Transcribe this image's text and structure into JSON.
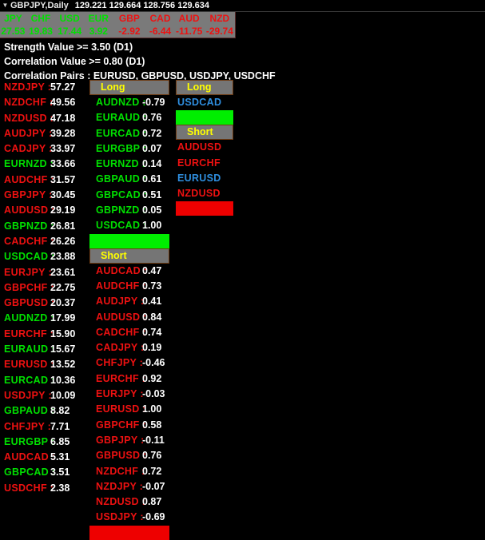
{
  "titlebar": {
    "caret_icon": "chevron-down-icon",
    "symbol": "GBPJPY,Daily",
    "quotes": "129.221 129.664 128.756 129.634"
  },
  "strength_panel": {
    "currencies": [
      "JPY",
      "CHF",
      "USD",
      "EUR",
      "GBP",
      "CAD",
      "AUD",
      "NZD"
    ],
    "values": [
      "27.53",
      "19.83",
      "17.44",
      "3.92",
      "-2.92",
      "-6.44",
      "-11.75",
      "-29.74"
    ]
  },
  "criteria": {
    "line1": "Strength Value >= 3.50    (D1)",
    "line2": "Correlation Value >= 0.80    (D1)",
    "line3": "Correlation Pairs : EURUSD, GBPUSD, USDJPY, USDCHF"
  },
  "strength_list": {
    "rows": [
      {
        "pair": "NZDJPY :",
        "value": "57.27",
        "dir": "down"
      },
      {
        "pair": "NZDCHF :",
        "value": "49.56",
        "dir": "down"
      },
      {
        "pair": "NZDUSD :",
        "value": "47.18",
        "dir": "down"
      },
      {
        "pair": "AUDJPY :",
        "value": "39.28",
        "dir": "down"
      },
      {
        "pair": "CADJPY :",
        "value": "33.97",
        "dir": "down"
      },
      {
        "pair": "EURNZD :",
        "value": "33.66",
        "dir": "up"
      },
      {
        "pair": "AUDCHF :",
        "value": "31.57",
        "dir": "down"
      },
      {
        "pair": "GBPJPY :",
        "value": "30.45",
        "dir": "down"
      },
      {
        "pair": "AUDUSD :",
        "value": "29.19",
        "dir": "down"
      },
      {
        "pair": "GBPNZD :",
        "value": "26.81",
        "dir": "up"
      },
      {
        "pair": "CADCHF :",
        "value": "26.26",
        "dir": "down"
      },
      {
        "pair": "USDCAD :",
        "value": "23.88",
        "dir": "up"
      },
      {
        "pair": "EURJPY :",
        "value": "23.61",
        "dir": "down"
      },
      {
        "pair": "GBPCHF :",
        "value": "22.75",
        "dir": "down"
      },
      {
        "pair": "GBPUSD :",
        "value": "20.37",
        "dir": "down"
      },
      {
        "pair": "AUDNZD :",
        "value": "17.99",
        "dir": "up"
      },
      {
        "pair": "EURCHF :",
        "value": "15.90",
        "dir": "down"
      },
      {
        "pair": "EURAUD :",
        "value": "15.67",
        "dir": "up"
      },
      {
        "pair": "EURUSD :",
        "value": "13.52",
        "dir": "down"
      },
      {
        "pair": "EURCAD :",
        "value": "10.36",
        "dir": "up"
      },
      {
        "pair": "USDJPY :",
        "value": "10.09",
        "dir": "down"
      },
      {
        "pair": "GBPAUD :",
        "value": "8.82",
        "dir": "up"
      },
      {
        "pair": "CHFJPY :",
        "value": "7.71",
        "dir": "down"
      },
      {
        "pair": "EURGBP :",
        "value": "6.85",
        "dir": "up"
      },
      {
        "pair": "AUDCAD :",
        "value": "5.31",
        "dir": "down"
      },
      {
        "pair": "GBPCAD :",
        "value": "3.51",
        "dir": "up"
      },
      {
        "pair": "USDCHF :",
        "value": "2.38",
        "dir": "down"
      }
    ]
  },
  "correlation": {
    "long_header": "Long",
    "short_header": "Short",
    "long_rows": [
      {
        "pair": "AUDNZD :",
        "value": "-0.79"
      },
      {
        "pair": "EURAUD :",
        "value": "0.76"
      },
      {
        "pair": "EURCAD :",
        "value": "0.72"
      },
      {
        "pair": "EURGBP :",
        "value": "0.07"
      },
      {
        "pair": "EURNZD :",
        "value": "0.14"
      },
      {
        "pair": "GBPAUD :",
        "value": "0.61"
      },
      {
        "pair": "GBPCAD :",
        "value": "0.51"
      },
      {
        "pair": "GBPNZD :",
        "value": "0.05"
      },
      {
        "pair": "USDCAD :",
        "value": "1.00"
      }
    ],
    "short_rows": [
      {
        "pair": "AUDCAD :",
        "value": "0.47"
      },
      {
        "pair": "AUDCHF :",
        "value": "0.73"
      },
      {
        "pair": "AUDJPY :",
        "value": "0.41"
      },
      {
        "pair": "AUDUSD :",
        "value": "0.84"
      },
      {
        "pair": "CADCHF :",
        "value": "0.74"
      },
      {
        "pair": "CADJPY :",
        "value": "0.19"
      },
      {
        "pair": "CHFJPY :",
        "value": "-0.46"
      },
      {
        "pair": "EURCHF :",
        "value": "0.92"
      },
      {
        "pair": "EURJPY :",
        "value": "-0.03"
      },
      {
        "pair": "EURUSD :",
        "value": "1.00"
      },
      {
        "pair": "GBPCHF :",
        "value": "0.58"
      },
      {
        "pair": "GBPJPY :",
        "value": "-0.11"
      },
      {
        "pair": "GBPUSD :",
        "value": "0.76"
      },
      {
        "pair": "NZDCHF :",
        "value": "0.72"
      },
      {
        "pair": "NZDJPY :",
        "value": "-0.07"
      },
      {
        "pair": "NZDUSD :",
        "value": "0.87"
      },
      {
        "pair": "USDJPY :",
        "value": "-0.69"
      }
    ]
  },
  "signals": {
    "long_header": "Long",
    "short_header": "Short",
    "long_rows": [
      {
        "pair": "USDCAD",
        "color": "blue"
      }
    ],
    "short_rows": [
      {
        "pair": "AUDUSD",
        "color": "down"
      },
      {
        "pair": "EURCHF",
        "color": "down"
      },
      {
        "pair": "EURUSD",
        "color": "blue"
      },
      {
        "pair": "NZDUSD",
        "color": "down"
      }
    ]
  },
  "colors": {
    "bullish": "#00e000",
    "bearish": "#ee1111",
    "highlight": "#2f8fe0",
    "header_bg": "#757575",
    "header_text": "#ffff00",
    "bar_green": "#00ee00",
    "bar_red": "#ee0000",
    "background": "#000000"
  }
}
